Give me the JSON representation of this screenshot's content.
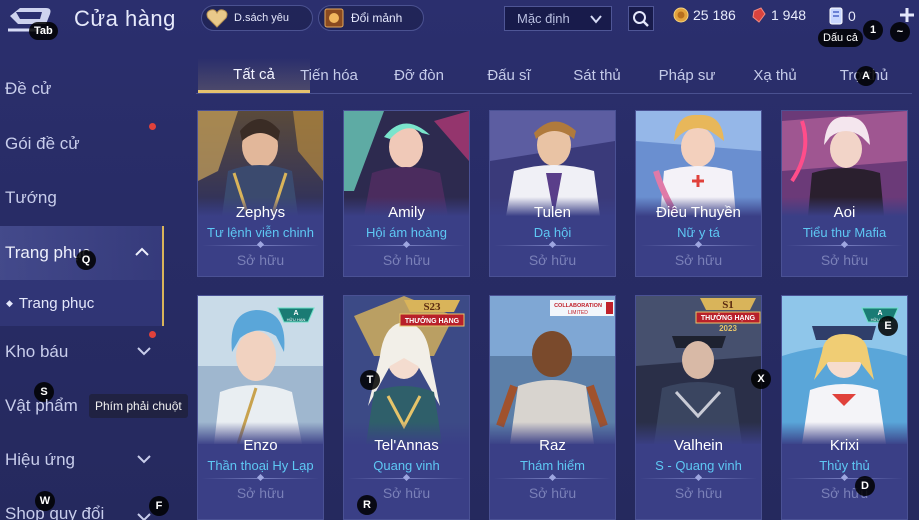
{
  "header": {
    "title": "Cửa hàng",
    "tab_hotkey": "Tab",
    "wishlist_label": "D.sách yêu",
    "exchange_label": "Đổi mảnh",
    "sort": {
      "value": "Mặc định"
    },
    "gold": "25 186",
    "rubies": "1 948",
    "vouchers": "0",
    "voucher_tooltip": "Dấu cả",
    "hotkey_1": "1",
    "hotkey_tilde": "~"
  },
  "sidebar": {
    "items": [
      {
        "label": "Đề cử"
      },
      {
        "label": "Gói đề cử"
      },
      {
        "label": "Tướng"
      },
      {
        "label": "Trang phục"
      },
      {
        "label": "Trang phục"
      },
      {
        "label": "Kho báu"
      },
      {
        "label": "Vật phẩm"
      },
      {
        "label": "Hiệu ứng"
      },
      {
        "label": "Shop quy đổi"
      }
    ],
    "tooltip": "Phím phải chuột",
    "hotkeys": {
      "q": "Q",
      "s": "S",
      "w": "W",
      "f": "F"
    }
  },
  "tabs": [
    {
      "label": "Tất cả"
    },
    {
      "label": "Tiến hóa"
    },
    {
      "label": "Đỡ đòn"
    },
    {
      "label": "Đấu sĩ"
    },
    {
      "label": "Sát thủ"
    },
    {
      "label": "Pháp sư"
    },
    {
      "label": "Xạ thủ"
    },
    {
      "label": "Trợ thủ"
    }
  ],
  "tab_hotkey_a": "A",
  "cards": [
    {
      "hero": "Zephys",
      "skin": "Tư lệnh viễn chinh",
      "status": "Sở hữu"
    },
    {
      "hero": "Amily",
      "skin": "Hội ám hoàng",
      "status": "Sở hữu"
    },
    {
      "hero": "Tulen",
      "skin": "Dạ hội",
      "status": "Sở hữu"
    },
    {
      "hero": "Điêu Thuyền",
      "skin": "Nữ y tá",
      "status": "Sở hữu"
    },
    {
      "hero": "Aoi",
      "skin": "Tiểu thư Mafia",
      "status": "Sở hữu"
    },
    {
      "hero": "Enzo",
      "skin": "Thần thoại Hy Lạp",
      "status": "Sở hữu",
      "badge": "A",
      "badge_sub": "HỮU HẠN"
    },
    {
      "hero": "Tel'Annas",
      "skin": "Quang vinh",
      "status": "Sở hữu",
      "rank": "S23",
      "rank_sub": "THƯỞNG HẠNG"
    },
    {
      "hero": "Raz",
      "skin": "Thám hiểm",
      "status": "Sở hữu",
      "collab": "COLLABORATION",
      "collab_sub": "LIMITED"
    },
    {
      "hero": "Valhein",
      "skin": "S - Quang vinh",
      "status": "Sở hữu",
      "rank": "S1",
      "rank_sub": "THƯỞNG HẠNG",
      "rank_year": "2023"
    },
    {
      "hero": "Krixi",
      "skin": "Thủy thủ",
      "status": "Sở hữu",
      "badge": "A",
      "badge_sub": "HỮU HẠN"
    }
  ],
  "card_hotkeys": {
    "t": "T",
    "r": "R",
    "x": "X",
    "e": "E",
    "d": "D"
  },
  "colors": {
    "accent": "#e5c26e",
    "skin_text": "#5ec8f4",
    "owned_text": "#7a80b8",
    "background": "#2b2f6e"
  }
}
